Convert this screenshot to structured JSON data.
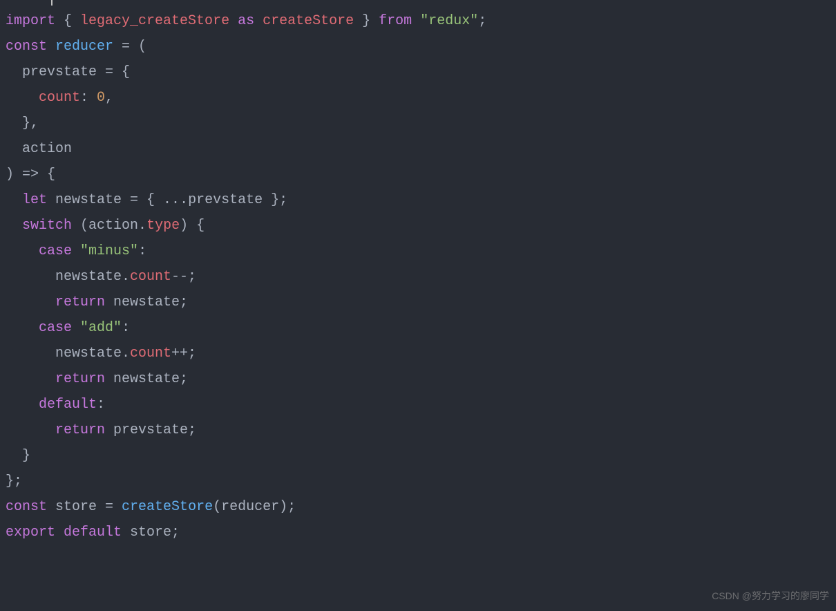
{
  "code": {
    "line1": {
      "t1": "import",
      "t2": " { ",
      "t3": "legacy_createStore",
      "t4": " ",
      "t5": "as",
      "t6": " ",
      "t7": "createStore",
      "t8": " } ",
      "t9": "from",
      "t10": " ",
      "t11": "\"redux\"",
      "t12": ";"
    },
    "line2": {
      "t1": "const",
      "t2": " ",
      "t3": "reducer",
      "t4": " = ("
    },
    "line3": {
      "t1": "  prevstate = {"
    },
    "line4": {
      "t1": "    ",
      "t2": "count",
      "t3": ": ",
      "t4": "0",
      "t5": ","
    },
    "line5": {
      "t1": "  },"
    },
    "line6": {
      "t1": "  action"
    },
    "line7": {
      "t1": ") => {"
    },
    "line8": {
      "t1": "  ",
      "t2": "let",
      "t3": " newstate = { ...prevstate };"
    },
    "line9": {
      "t1": "  ",
      "t2": "switch",
      "t3": " (action.",
      "t4": "type",
      "t5": ") {"
    },
    "line10": {
      "t1": "    ",
      "t2": "case",
      "t3": " ",
      "t4": "\"minus\"",
      "t5": ":"
    },
    "line11": {
      "t1": "      newstate.",
      "t2": "count",
      "t3": "--;"
    },
    "line12": {
      "t1": "      ",
      "t2": "return",
      "t3": " newstate;"
    },
    "line13": {
      "t1": "    ",
      "t2": "case",
      "t3": " ",
      "t4": "\"add\"",
      "t5": ":"
    },
    "line14": {
      "t1": "      newstate.",
      "t2": "count",
      "t3": "++;"
    },
    "line15": {
      "t1": "      ",
      "t2": "return",
      "t3": " newstate;"
    },
    "line16": {
      "t1": "    ",
      "t2": "default",
      "t3": ":"
    },
    "line17": {
      "t1": "      ",
      "t2": "return",
      "t3": " prevstate;"
    },
    "line18": {
      "t1": "  }"
    },
    "line19": {
      "t1": "};"
    },
    "line20": {
      "t1": "const",
      "t2": " store = ",
      "t3": "createStore",
      "t4": "(reducer);"
    },
    "line21": {
      "t1": "export",
      "t2": " ",
      "t3": "default",
      "t4": " store;"
    }
  },
  "watermark": "CSDN @努力学习的廖同学"
}
